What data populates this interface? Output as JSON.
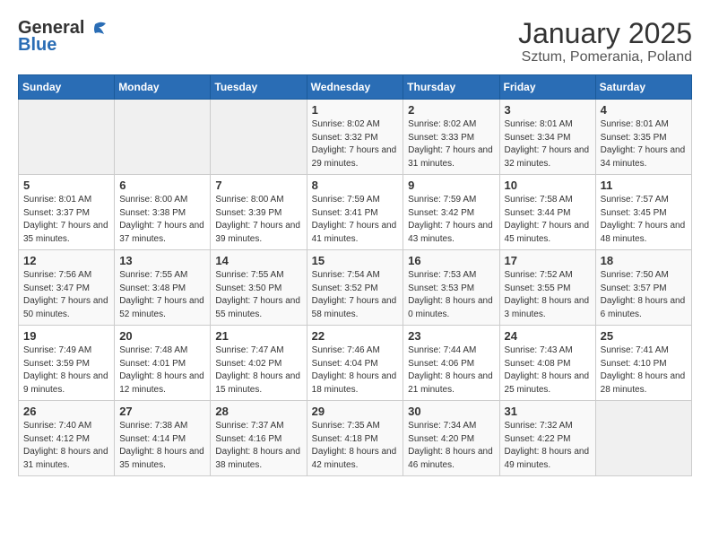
{
  "header": {
    "logo_general": "General",
    "logo_blue": "Blue",
    "title": "January 2025",
    "subtitle": "Sztum, Pomerania, Poland"
  },
  "weekdays": [
    "Sunday",
    "Monday",
    "Tuesday",
    "Wednesday",
    "Thursday",
    "Friday",
    "Saturday"
  ],
  "weeks": [
    [
      {
        "day": "",
        "sunrise": "",
        "sunset": "",
        "daylight": ""
      },
      {
        "day": "",
        "sunrise": "",
        "sunset": "",
        "daylight": ""
      },
      {
        "day": "",
        "sunrise": "",
        "sunset": "",
        "daylight": ""
      },
      {
        "day": "1",
        "sunrise": "Sunrise: 8:02 AM",
        "sunset": "Sunset: 3:32 PM",
        "daylight": "Daylight: 7 hours and 29 minutes."
      },
      {
        "day": "2",
        "sunrise": "Sunrise: 8:02 AM",
        "sunset": "Sunset: 3:33 PM",
        "daylight": "Daylight: 7 hours and 31 minutes."
      },
      {
        "day": "3",
        "sunrise": "Sunrise: 8:01 AM",
        "sunset": "Sunset: 3:34 PM",
        "daylight": "Daylight: 7 hours and 32 minutes."
      },
      {
        "day": "4",
        "sunrise": "Sunrise: 8:01 AM",
        "sunset": "Sunset: 3:35 PM",
        "daylight": "Daylight: 7 hours and 34 minutes."
      }
    ],
    [
      {
        "day": "5",
        "sunrise": "Sunrise: 8:01 AM",
        "sunset": "Sunset: 3:37 PM",
        "daylight": "Daylight: 7 hours and 35 minutes."
      },
      {
        "day": "6",
        "sunrise": "Sunrise: 8:00 AM",
        "sunset": "Sunset: 3:38 PM",
        "daylight": "Daylight: 7 hours and 37 minutes."
      },
      {
        "day": "7",
        "sunrise": "Sunrise: 8:00 AM",
        "sunset": "Sunset: 3:39 PM",
        "daylight": "Daylight: 7 hours and 39 minutes."
      },
      {
        "day": "8",
        "sunrise": "Sunrise: 7:59 AM",
        "sunset": "Sunset: 3:41 PM",
        "daylight": "Daylight: 7 hours and 41 minutes."
      },
      {
        "day": "9",
        "sunrise": "Sunrise: 7:59 AM",
        "sunset": "Sunset: 3:42 PM",
        "daylight": "Daylight: 7 hours and 43 minutes."
      },
      {
        "day": "10",
        "sunrise": "Sunrise: 7:58 AM",
        "sunset": "Sunset: 3:44 PM",
        "daylight": "Daylight: 7 hours and 45 minutes."
      },
      {
        "day": "11",
        "sunrise": "Sunrise: 7:57 AM",
        "sunset": "Sunset: 3:45 PM",
        "daylight": "Daylight: 7 hours and 48 minutes."
      }
    ],
    [
      {
        "day": "12",
        "sunrise": "Sunrise: 7:56 AM",
        "sunset": "Sunset: 3:47 PM",
        "daylight": "Daylight: 7 hours and 50 minutes."
      },
      {
        "day": "13",
        "sunrise": "Sunrise: 7:55 AM",
        "sunset": "Sunset: 3:48 PM",
        "daylight": "Daylight: 7 hours and 52 minutes."
      },
      {
        "day": "14",
        "sunrise": "Sunrise: 7:55 AM",
        "sunset": "Sunset: 3:50 PM",
        "daylight": "Daylight: 7 hours and 55 minutes."
      },
      {
        "day": "15",
        "sunrise": "Sunrise: 7:54 AM",
        "sunset": "Sunset: 3:52 PM",
        "daylight": "Daylight: 7 hours and 58 minutes."
      },
      {
        "day": "16",
        "sunrise": "Sunrise: 7:53 AM",
        "sunset": "Sunset: 3:53 PM",
        "daylight": "Daylight: 8 hours and 0 minutes."
      },
      {
        "day": "17",
        "sunrise": "Sunrise: 7:52 AM",
        "sunset": "Sunset: 3:55 PM",
        "daylight": "Daylight: 8 hours and 3 minutes."
      },
      {
        "day": "18",
        "sunrise": "Sunrise: 7:50 AM",
        "sunset": "Sunset: 3:57 PM",
        "daylight": "Daylight: 8 hours and 6 minutes."
      }
    ],
    [
      {
        "day": "19",
        "sunrise": "Sunrise: 7:49 AM",
        "sunset": "Sunset: 3:59 PM",
        "daylight": "Daylight: 8 hours and 9 minutes."
      },
      {
        "day": "20",
        "sunrise": "Sunrise: 7:48 AM",
        "sunset": "Sunset: 4:01 PM",
        "daylight": "Daylight: 8 hours and 12 minutes."
      },
      {
        "day": "21",
        "sunrise": "Sunrise: 7:47 AM",
        "sunset": "Sunset: 4:02 PM",
        "daylight": "Daylight: 8 hours and 15 minutes."
      },
      {
        "day": "22",
        "sunrise": "Sunrise: 7:46 AM",
        "sunset": "Sunset: 4:04 PM",
        "daylight": "Daylight: 8 hours and 18 minutes."
      },
      {
        "day": "23",
        "sunrise": "Sunrise: 7:44 AM",
        "sunset": "Sunset: 4:06 PM",
        "daylight": "Daylight: 8 hours and 21 minutes."
      },
      {
        "day": "24",
        "sunrise": "Sunrise: 7:43 AM",
        "sunset": "Sunset: 4:08 PM",
        "daylight": "Daylight: 8 hours and 25 minutes."
      },
      {
        "day": "25",
        "sunrise": "Sunrise: 7:41 AM",
        "sunset": "Sunset: 4:10 PM",
        "daylight": "Daylight: 8 hours and 28 minutes."
      }
    ],
    [
      {
        "day": "26",
        "sunrise": "Sunrise: 7:40 AM",
        "sunset": "Sunset: 4:12 PM",
        "daylight": "Daylight: 8 hours and 31 minutes."
      },
      {
        "day": "27",
        "sunrise": "Sunrise: 7:38 AM",
        "sunset": "Sunset: 4:14 PM",
        "daylight": "Daylight: 8 hours and 35 minutes."
      },
      {
        "day": "28",
        "sunrise": "Sunrise: 7:37 AM",
        "sunset": "Sunset: 4:16 PM",
        "daylight": "Daylight: 8 hours and 38 minutes."
      },
      {
        "day": "29",
        "sunrise": "Sunrise: 7:35 AM",
        "sunset": "Sunset: 4:18 PM",
        "daylight": "Daylight: 8 hours and 42 minutes."
      },
      {
        "day": "30",
        "sunrise": "Sunrise: 7:34 AM",
        "sunset": "Sunset: 4:20 PM",
        "daylight": "Daylight: 8 hours and 46 minutes."
      },
      {
        "day": "31",
        "sunrise": "Sunrise: 7:32 AM",
        "sunset": "Sunset: 4:22 PM",
        "daylight": "Daylight: 8 hours and 49 minutes."
      },
      {
        "day": "",
        "sunrise": "",
        "sunset": "",
        "daylight": ""
      }
    ]
  ]
}
